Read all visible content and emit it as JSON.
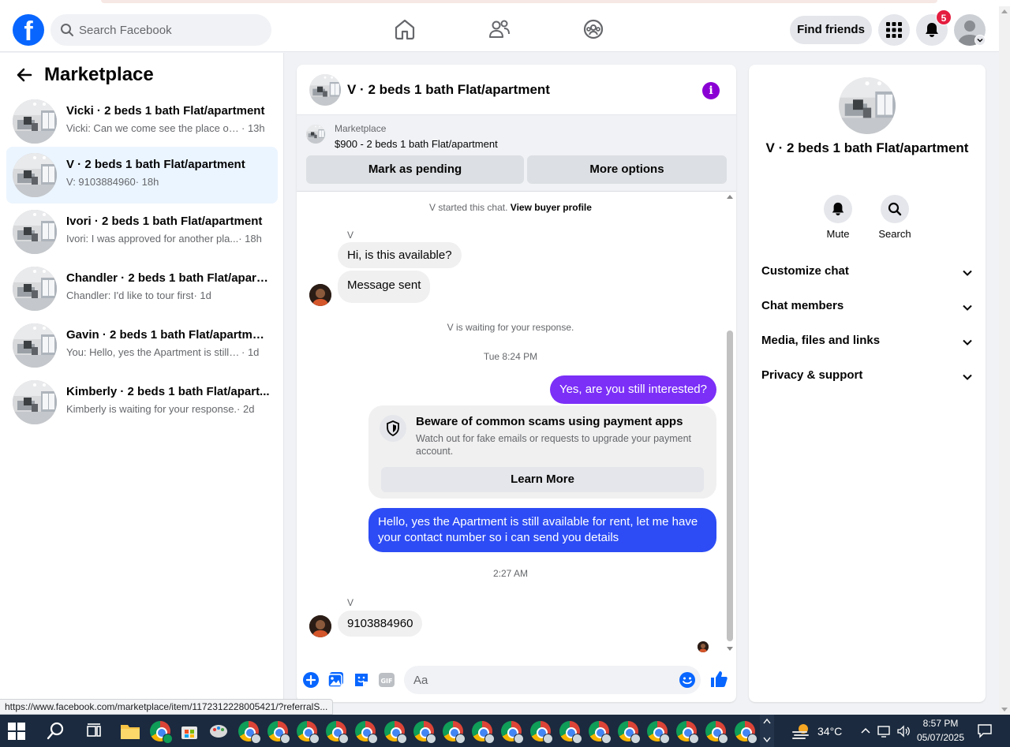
{
  "header": {
    "search_placeholder": "Search Facebook",
    "find_friends": "Find friends",
    "notification_count": "5"
  },
  "sidebar": {
    "title": "Marketplace",
    "conversations": [
      {
        "title": "Vicki · 2 beds 1 bath Flat/apartment",
        "preview": "Vicki: Can we come see the place on...",
        "time": " · 13h",
        "active": false
      },
      {
        "title": "V · 2 beds 1 bath Flat/apartment",
        "preview": "V: 9103884960",
        "time": " · 18h",
        "active": true
      },
      {
        "title": "Ivori · 2 beds 1 bath Flat/apartment",
        "preview": "Ivori: I was approved for another pla...",
        "time": " · 18h",
        "active": false
      },
      {
        "title": "Chandler · 2 beds 1 bath Flat/apart...",
        "preview": "Chandler: I'd like to tour first",
        "time": " · 1d",
        "active": false
      },
      {
        "title": "Gavin · 2 beds 1 bath Flat/apartment",
        "preview": "You: Hello, yes the Apartment is still a...",
        "time": " · 1d",
        "active": false
      },
      {
        "title": "Kimberly · 2 beds 1 bath Flat/apart...",
        "preview": "Kimberly is waiting for your response.",
        "time": " · 2d",
        "active": false
      }
    ]
  },
  "chat": {
    "title": "V · 2 beds 1 bath Flat/apartment",
    "listing_label": "Marketplace",
    "listing_price": "$900 - 2 beds 1 bath Flat/apartment",
    "mark_pending": "Mark as pending",
    "more_options": "More options",
    "started_text": "V started this chat.",
    "view_profile": "View buyer profile",
    "sender1": "V",
    "msg1": "Hi, is this available?",
    "msg2": "Message sent",
    "waiting": "V is waiting for your response.",
    "date1": "Tue 8:24 PM",
    "out1": "Yes, are you still interested?",
    "scam_title": "Beware of common scams using payment apps",
    "scam_body": "Watch out for fake emails or requests to upgrade your payment account.",
    "learn_more": "Learn More",
    "out2": "Hello, yes the Apartment is still available for rent, let me have your contact number so i can send you details",
    "date2": "2:27 AM",
    "sender2": "V",
    "msg3": "9103884960",
    "composer_placeholder": "Aa"
  },
  "info_panel": {
    "name": "V · 2 beds 1 bath Flat/apartment",
    "mute": "Mute",
    "search": "Search",
    "rows": [
      "Customize chat",
      "Chat members",
      "Media, files and links",
      "Privacy & support"
    ]
  },
  "status_url": "https://www.facebook.com/marketplace/item/1172312228005421/?referralS...",
  "taskbar": {
    "temperature": "34°C",
    "time": "8:57 PM",
    "date": "05/07/2025"
  },
  "colors": {
    "accent": "#0866ff",
    "out_purple": "#7b2ff7",
    "out_blue": "#2d4cf5",
    "info_purple": "#8a00d4",
    "active_row": "#ebf5ff"
  }
}
